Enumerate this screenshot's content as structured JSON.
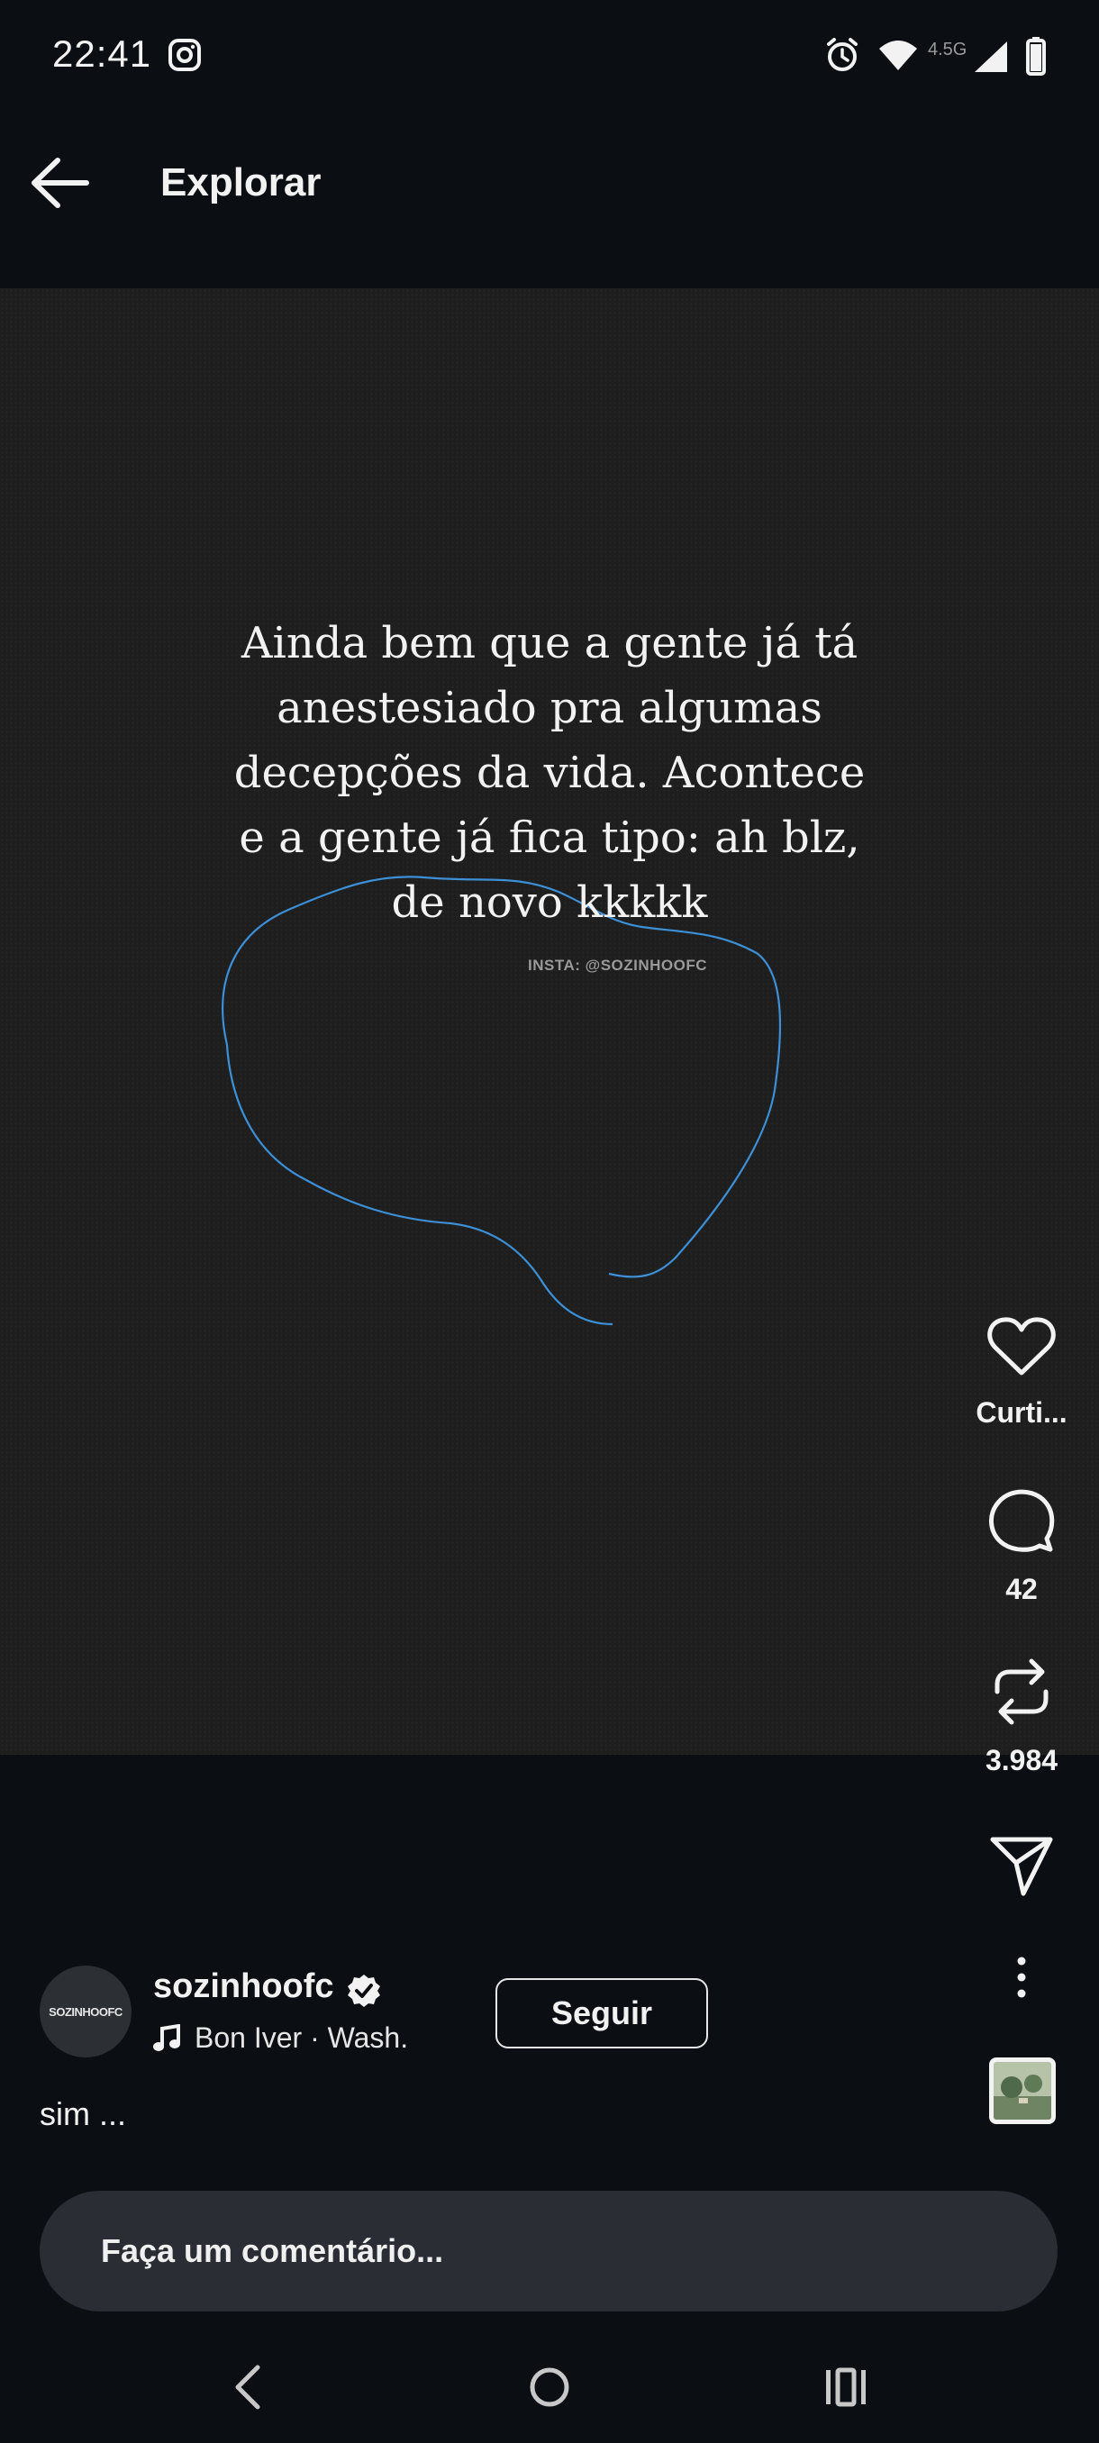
{
  "status_bar": {
    "time": "22:41",
    "icons": [
      "instagram-icon",
      "alarm-icon",
      "wifi-icon",
      "network-4.5g-icon",
      "signal-icon",
      "battery-icon"
    ],
    "network_label": "4.5G"
  },
  "header": {
    "title": "Explorar"
  },
  "post": {
    "quote_lines": [
      "Ainda bem que a gente já tá",
      "anestesiado pra algumas",
      "decepções da vida. Acontece",
      "e a gente já fica tipo: ah blz,",
      "de novo kkkkk"
    ],
    "watermark": "INSTA: @SOZINHOOFC",
    "scribble_color": "#3d8fd6"
  },
  "actions": {
    "like_label": "Curti...",
    "comments_count": "42",
    "reposts_count": "3.984"
  },
  "author": {
    "avatar_text": "SOZINHOOFC",
    "username": "sozinhoofc",
    "verified": true,
    "music": "Bon Iver · Wash.",
    "follow_label": "Seguir",
    "caption": "sim ..."
  },
  "comment": {
    "placeholder": "Faça um comentário..."
  },
  "colors": {
    "background": "#0b0e13",
    "media_background": "#1e1e1e",
    "comment_box": "#2a2d33"
  }
}
